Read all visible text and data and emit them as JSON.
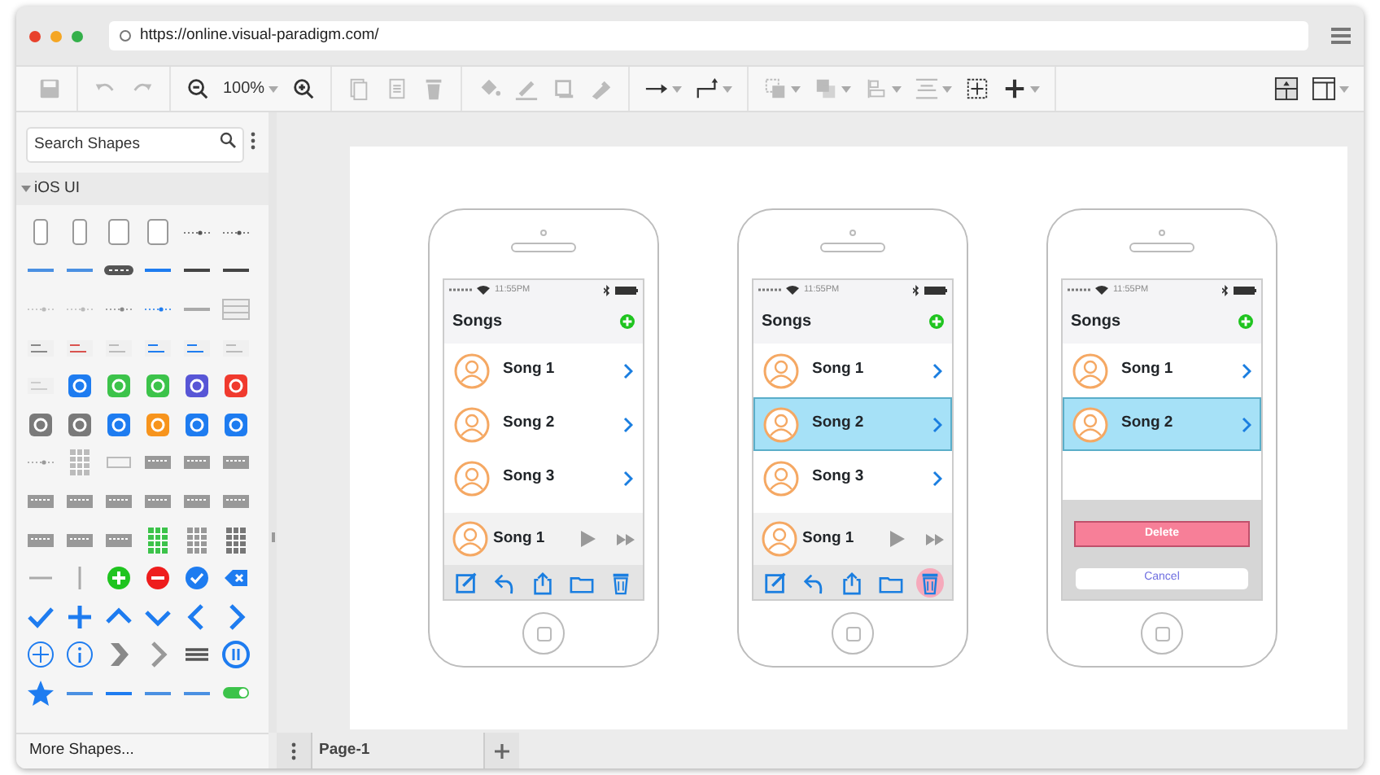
{
  "browser": {
    "url": "https://online.visual-paradigm.com/",
    "dots": [
      {
        "color": "#e8412c"
      },
      {
        "color": "#f5a623"
      },
      {
        "color": "#34b04a"
      }
    ]
  },
  "toolbar": {
    "groups": [
      [
        {
          "kind": "save",
          "disabled": true,
          "dropdown": false
        }
      ],
      [
        {
          "kind": "undo",
          "disabled": true,
          "dropdown": false
        },
        {
          "kind": "redo",
          "disabled": true,
          "dropdown": false
        }
      ],
      [
        {
          "kind": "zoom-out",
          "disabled": false,
          "dropdown": false
        },
        {
          "kind": "zoom",
          "value": "100%",
          "disabled": false,
          "dropdown": true
        },
        {
          "kind": "zoom-in",
          "disabled": false,
          "dropdown": false
        }
      ],
      [
        {
          "kind": "copy",
          "disabled": true,
          "dropdown": false
        },
        {
          "kind": "paste",
          "disabled": true,
          "dropdown": false
        },
        {
          "kind": "delete",
          "disabled": true,
          "dropdown": false
        }
      ],
      [
        {
          "kind": "fill",
          "disabled": true,
          "dropdown": false
        },
        {
          "kind": "pen",
          "disabled": true,
          "dropdown": false
        },
        {
          "kind": "shadow",
          "disabled": true,
          "dropdown": false
        },
        {
          "kind": "brush",
          "disabled": true,
          "dropdown": false
        }
      ],
      [
        {
          "kind": "arrow",
          "disabled": false,
          "dropdown": true
        },
        {
          "kind": "elbow",
          "disabled": false,
          "dropdown": true
        }
      ],
      [
        {
          "kind": "front",
          "disabled": true,
          "dropdown": true
        },
        {
          "kind": "back",
          "disabled": true,
          "dropdown": true
        },
        {
          "kind": "align",
          "disabled": true,
          "dropdown": true
        },
        {
          "kind": "distribute",
          "disabled": true,
          "dropdown": true
        },
        {
          "kind": "fit",
          "disabled": false,
          "dropdown": false
        },
        {
          "kind": "plus",
          "disabled": false,
          "dropdown": true
        }
      ]
    ],
    "right": [
      {
        "kind": "layout",
        "disabled": false,
        "dropdown": false
      },
      {
        "kind": "panel",
        "disabled": false,
        "dropdown": true
      }
    ]
  },
  "sidebar": {
    "search": {
      "placeholder": "Search Shapes"
    },
    "category": {
      "label": "iOS UI",
      "expanded": true
    },
    "more": "More Shapes...",
    "shapes": [
      {
        "kind": "phone",
        "color": "#999999"
      },
      {
        "kind": "phone",
        "color": "#999999"
      },
      {
        "kind": "tablet",
        "color": "#999999"
      },
      {
        "kind": "tablet",
        "color": "#999999"
      },
      {
        "kind": "slider",
        "color": "#555555"
      },
      {
        "kind": "slider",
        "color": "#555555"
      },
      {
        "kind": "bar",
        "color": "#4a90e2"
      },
      {
        "kind": "bar",
        "color": "#4a90e2"
      },
      {
        "kind": "segmented",
        "color": "#555555"
      },
      {
        "kind": "bar",
        "color": "#1e7cf0"
      },
      {
        "kind": "bar",
        "color": "#444444"
      },
      {
        "kind": "bar",
        "color": "#444444"
      },
      {
        "kind": "slider",
        "color": "#bbbbbb"
      },
      {
        "kind": "slider",
        "color": "#bbbbbb"
      },
      {
        "kind": "slider",
        "color": "#888888"
      },
      {
        "kind": "slider",
        "color": "#1e7cf0"
      },
      {
        "kind": "bar",
        "color": "#aaaaaa"
      },
      {
        "kind": "table",
        "color": "#bbbbbb"
      },
      {
        "kind": "list",
        "color": "#888888"
      },
      {
        "kind": "list",
        "color": "#d9534f"
      },
      {
        "kind": "list",
        "color": "#bbbbbb"
      },
      {
        "kind": "list",
        "color": "#1e7cf0"
      },
      {
        "kind": "list",
        "color": "#1e7cf0"
      },
      {
        "kind": "list",
        "color": "#bbbbbb"
      },
      {
        "kind": "list",
        "color": "#cccccc"
      },
      {
        "kind": "tile",
        "color": "#1e7cf0"
      },
      {
        "kind": "tile",
        "color": "#3cc34a"
      },
      {
        "kind": "tile",
        "color": "#3cc34a"
      },
      {
        "kind": "tile",
        "color": "#5856d6"
      },
      {
        "kind": "tile",
        "color": "#f03a2e"
      },
      {
        "kind": "tile",
        "color": "#7a7a7a"
      },
      {
        "kind": "tile",
        "color": "#7a7a7a"
      },
      {
        "kind": "tile",
        "color": "#1e7cf0"
      },
      {
        "kind": "tile",
        "color": "#f7941d"
      },
      {
        "kind": "tile",
        "color": "#1e7cf0"
      },
      {
        "kind": "tile",
        "color": "#1e7cf0"
      },
      {
        "kind": "slider",
        "color": "#999999"
      },
      {
        "kind": "keypad",
        "color": "#bbbbbb"
      },
      {
        "kind": "field",
        "color": "#bbbbbb"
      },
      {
        "kind": "keyboard",
        "color": "#999999"
      },
      {
        "kind": "keyboard",
        "color": "#999999"
      },
      {
        "kind": "keyboard",
        "color": "#999999"
      },
      {
        "kind": "keyboard",
        "color": "#999999"
      },
      {
        "kind": "keyboard",
        "color": "#999999"
      },
      {
        "kind": "keyboard",
        "color": "#999999"
      },
      {
        "kind": "keyboard",
        "color": "#999999"
      },
      {
        "kind": "keyboard",
        "color": "#999999"
      },
      {
        "kind": "keyboard",
        "color": "#999999"
      },
      {
        "kind": "keyboard",
        "color": "#999999"
      },
      {
        "kind": "keyboard",
        "color": "#999999"
      },
      {
        "kind": "keyboard",
        "color": "#999999"
      },
      {
        "kind": "keypad",
        "color": "#3cc34a"
      },
      {
        "kind": "keypad",
        "color": "#999999"
      },
      {
        "kind": "keypad",
        "color": "#777777"
      },
      {
        "kind": "hline",
        "color": "#aaaaaa"
      },
      {
        "kind": "vline",
        "color": "#aaaaaa"
      },
      {
        "kind": "circle-plus",
        "color": "#1fc41f"
      },
      {
        "kind": "circle-minus",
        "color": "#ee1c1c"
      },
      {
        "kind": "circle-check",
        "color": "#1e7cf0"
      },
      {
        "kind": "circle-x",
        "color": "#1e7cf0"
      },
      {
        "kind": "check",
        "color": "#1e7cf0"
      },
      {
        "kind": "plus",
        "color": "#1e7cf0"
      },
      {
        "kind": "caret-up",
        "color": "#1e7cf0"
      },
      {
        "kind": "caret-down",
        "color": "#1e7cf0"
      },
      {
        "kind": "chevron-left",
        "color": "#1e7cf0"
      },
      {
        "kind": "chevron-right",
        "color": "#1e7cf0"
      },
      {
        "kind": "plus-outline",
        "color": "#1e7cf0"
      },
      {
        "kind": "info",
        "color": "#1e7cf0"
      },
      {
        "kind": "chevron-bold",
        "color": "#888888"
      },
      {
        "kind": "chevron-right",
        "color": "#999999"
      },
      {
        "kind": "hamburger",
        "color": "#555555"
      },
      {
        "kind": "pause",
        "color": "#1e7cf0"
      },
      {
        "kind": "star",
        "color": "#1e7cf0"
      },
      {
        "kind": "bar",
        "color": "#4a90e2"
      },
      {
        "kind": "bar",
        "color": "#1e7cf0"
      },
      {
        "kind": "bar",
        "color": "#4a90e2"
      },
      {
        "kind": "bar",
        "color": "#4a90e2"
      },
      {
        "kind": "switch",
        "color": "#3cc34a"
      }
    ]
  },
  "phones": [
    {
      "time": "11:55PM",
      "title": "Songs",
      "songs": [
        {
          "title": "Song 1",
          "selected": false
        },
        {
          "title": "Song 2",
          "selected": false
        },
        {
          "title": "Song 3",
          "selected": false
        }
      ],
      "player": {
        "title": "Song 1"
      },
      "tools": [
        {
          "kind": "compose",
          "pressed": false
        },
        {
          "kind": "reply",
          "pressed": false
        },
        {
          "kind": "share",
          "pressed": false
        },
        {
          "kind": "folder",
          "pressed": false
        },
        {
          "kind": "trash",
          "pressed": false
        }
      ]
    },
    {
      "time": "11:55PM",
      "title": "Songs",
      "songs": [
        {
          "title": "Song 1",
          "selected": false
        },
        {
          "title": "Song 2",
          "selected": true
        },
        {
          "title": "Song 3",
          "selected": false
        }
      ],
      "player": {
        "title": "Song 1"
      },
      "tools": [
        {
          "kind": "compose",
          "pressed": false
        },
        {
          "kind": "reply",
          "pressed": false
        },
        {
          "kind": "share",
          "pressed": false
        },
        {
          "kind": "folder",
          "pressed": false
        },
        {
          "kind": "trash",
          "pressed": true
        }
      ]
    },
    {
      "time": "11:55PM",
      "title": "Songs",
      "songs": [
        {
          "title": "Song 1",
          "selected": false
        },
        {
          "title": "Song 2",
          "selected": true
        }
      ],
      "action_sheet": {
        "delete": "Delete",
        "cancel": "Cancel"
      }
    }
  ],
  "pages": [
    {
      "label": "Page-1",
      "selected": true
    }
  ]
}
